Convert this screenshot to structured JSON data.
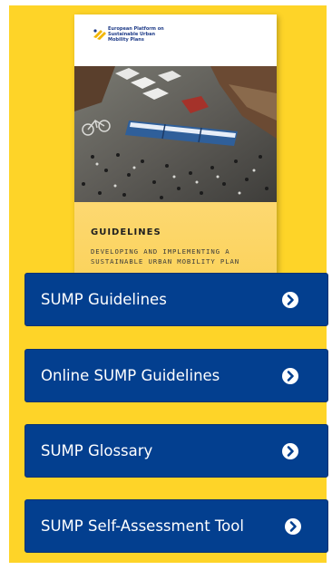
{
  "cover": {
    "title": "GUIDELINES",
    "subtitle": "DEVELOPING AND IMPLEMENTING A SUSTAINABLE URBAN MOBILITY PLAN",
    "logo_text": "European Platform on Sustainable Urban Mobility Plans",
    "icon": "eu-platform-logo-icon"
  },
  "menu": {
    "items": [
      {
        "label": "SUMP Guidelines",
        "icon": "chevron-right-circle-icon"
      },
      {
        "label": "Online SUMP Guidelines",
        "icon": "chevron-right-circle-icon"
      },
      {
        "label": "SUMP Glossary",
        "icon": "chevron-right-circle-icon"
      },
      {
        "label": "SUMP Self-Assessment Tool",
        "icon": "chevron-right-circle-icon"
      }
    ]
  },
  "colors": {
    "panel_background": "#fed428",
    "button_background": "#033f8f",
    "button_text": "#ffffff"
  }
}
